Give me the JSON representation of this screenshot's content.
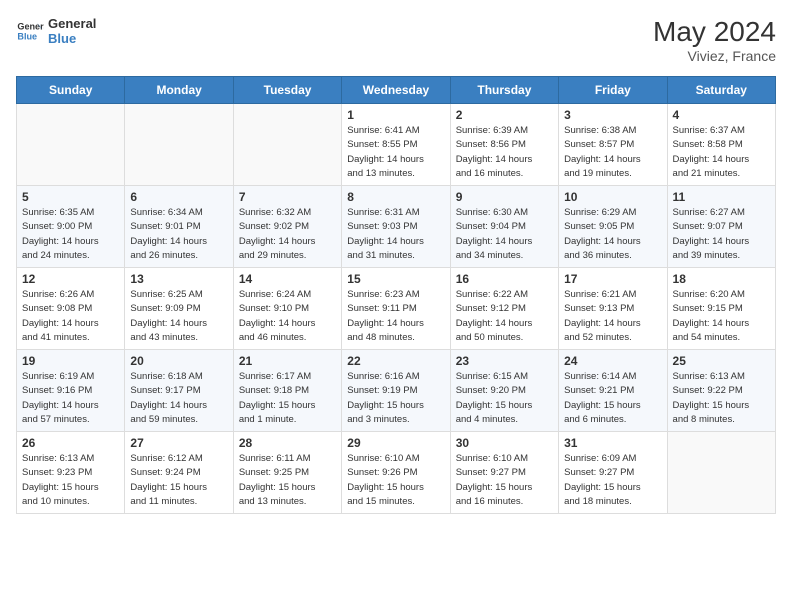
{
  "header": {
    "logo_line1": "General",
    "logo_line2": "Blue",
    "month_title": "May 2024",
    "location": "Viviez, France"
  },
  "days_of_week": [
    "Sunday",
    "Monday",
    "Tuesday",
    "Wednesday",
    "Thursday",
    "Friday",
    "Saturday"
  ],
  "weeks": [
    [
      {
        "day": "",
        "info": ""
      },
      {
        "day": "",
        "info": ""
      },
      {
        "day": "",
        "info": ""
      },
      {
        "day": "1",
        "info": "Sunrise: 6:41 AM\nSunset: 8:55 PM\nDaylight: 14 hours\nand 13 minutes."
      },
      {
        "day": "2",
        "info": "Sunrise: 6:39 AM\nSunset: 8:56 PM\nDaylight: 14 hours\nand 16 minutes."
      },
      {
        "day": "3",
        "info": "Sunrise: 6:38 AM\nSunset: 8:57 PM\nDaylight: 14 hours\nand 19 minutes."
      },
      {
        "day": "4",
        "info": "Sunrise: 6:37 AM\nSunset: 8:58 PM\nDaylight: 14 hours\nand 21 minutes."
      }
    ],
    [
      {
        "day": "5",
        "info": "Sunrise: 6:35 AM\nSunset: 9:00 PM\nDaylight: 14 hours\nand 24 minutes."
      },
      {
        "day": "6",
        "info": "Sunrise: 6:34 AM\nSunset: 9:01 PM\nDaylight: 14 hours\nand 26 minutes."
      },
      {
        "day": "7",
        "info": "Sunrise: 6:32 AM\nSunset: 9:02 PM\nDaylight: 14 hours\nand 29 minutes."
      },
      {
        "day": "8",
        "info": "Sunrise: 6:31 AM\nSunset: 9:03 PM\nDaylight: 14 hours\nand 31 minutes."
      },
      {
        "day": "9",
        "info": "Sunrise: 6:30 AM\nSunset: 9:04 PM\nDaylight: 14 hours\nand 34 minutes."
      },
      {
        "day": "10",
        "info": "Sunrise: 6:29 AM\nSunset: 9:05 PM\nDaylight: 14 hours\nand 36 minutes."
      },
      {
        "day": "11",
        "info": "Sunrise: 6:27 AM\nSunset: 9:07 PM\nDaylight: 14 hours\nand 39 minutes."
      }
    ],
    [
      {
        "day": "12",
        "info": "Sunrise: 6:26 AM\nSunset: 9:08 PM\nDaylight: 14 hours\nand 41 minutes."
      },
      {
        "day": "13",
        "info": "Sunrise: 6:25 AM\nSunset: 9:09 PM\nDaylight: 14 hours\nand 43 minutes."
      },
      {
        "day": "14",
        "info": "Sunrise: 6:24 AM\nSunset: 9:10 PM\nDaylight: 14 hours\nand 46 minutes."
      },
      {
        "day": "15",
        "info": "Sunrise: 6:23 AM\nSunset: 9:11 PM\nDaylight: 14 hours\nand 48 minutes."
      },
      {
        "day": "16",
        "info": "Sunrise: 6:22 AM\nSunset: 9:12 PM\nDaylight: 14 hours\nand 50 minutes."
      },
      {
        "day": "17",
        "info": "Sunrise: 6:21 AM\nSunset: 9:13 PM\nDaylight: 14 hours\nand 52 minutes."
      },
      {
        "day": "18",
        "info": "Sunrise: 6:20 AM\nSunset: 9:15 PM\nDaylight: 14 hours\nand 54 minutes."
      }
    ],
    [
      {
        "day": "19",
        "info": "Sunrise: 6:19 AM\nSunset: 9:16 PM\nDaylight: 14 hours\nand 57 minutes."
      },
      {
        "day": "20",
        "info": "Sunrise: 6:18 AM\nSunset: 9:17 PM\nDaylight: 14 hours\nand 59 minutes."
      },
      {
        "day": "21",
        "info": "Sunrise: 6:17 AM\nSunset: 9:18 PM\nDaylight: 15 hours\nand 1 minute."
      },
      {
        "day": "22",
        "info": "Sunrise: 6:16 AM\nSunset: 9:19 PM\nDaylight: 15 hours\nand 3 minutes."
      },
      {
        "day": "23",
        "info": "Sunrise: 6:15 AM\nSunset: 9:20 PM\nDaylight: 15 hours\nand 4 minutes."
      },
      {
        "day": "24",
        "info": "Sunrise: 6:14 AM\nSunset: 9:21 PM\nDaylight: 15 hours\nand 6 minutes."
      },
      {
        "day": "25",
        "info": "Sunrise: 6:13 AM\nSunset: 9:22 PM\nDaylight: 15 hours\nand 8 minutes."
      }
    ],
    [
      {
        "day": "26",
        "info": "Sunrise: 6:13 AM\nSunset: 9:23 PM\nDaylight: 15 hours\nand 10 minutes."
      },
      {
        "day": "27",
        "info": "Sunrise: 6:12 AM\nSunset: 9:24 PM\nDaylight: 15 hours\nand 11 minutes."
      },
      {
        "day": "28",
        "info": "Sunrise: 6:11 AM\nSunset: 9:25 PM\nDaylight: 15 hours\nand 13 minutes."
      },
      {
        "day": "29",
        "info": "Sunrise: 6:10 AM\nSunset: 9:26 PM\nDaylight: 15 hours\nand 15 minutes."
      },
      {
        "day": "30",
        "info": "Sunrise: 6:10 AM\nSunset: 9:27 PM\nDaylight: 15 hours\nand 16 minutes."
      },
      {
        "day": "31",
        "info": "Sunrise: 6:09 AM\nSunset: 9:27 PM\nDaylight: 15 hours\nand 18 minutes."
      },
      {
        "day": "",
        "info": ""
      }
    ]
  ]
}
